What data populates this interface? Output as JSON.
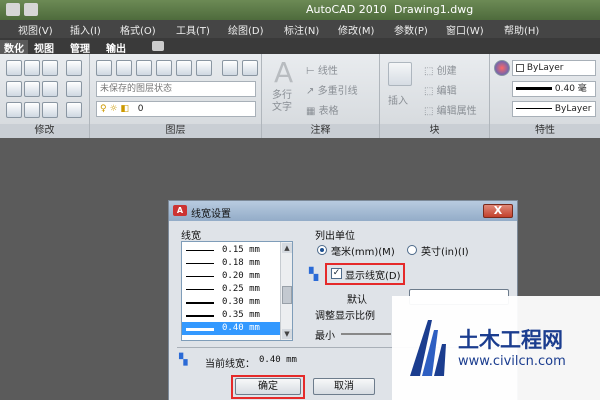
{
  "window": {
    "app_title": "AutoCAD 2010",
    "file_title": "Drawing1.dwg"
  },
  "menu": {
    "items": [
      "视图(V)",
      "插入(I)",
      "格式(O)",
      "工具(T)",
      "绘图(D)",
      "标注(N)",
      "修改(M)",
      "参数(P)",
      "窗口(W)",
      "帮助(H)"
    ]
  },
  "ribbon_tabs": {
    "items": [
      "数化",
      "视图",
      "管理",
      "输出"
    ],
    "active": "数化"
  },
  "ribbon": {
    "layer_state": "未保存的图层状态",
    "layer_current": "0",
    "annotation": {
      "text_label": "多行文字",
      "linear": "线性",
      "multileader": "多重引线",
      "table": "表格"
    },
    "block": {
      "insert": "插入",
      "create": "创建",
      "edit": "编辑",
      "edit_attr": "编辑属性"
    },
    "properties": {
      "color": "ByLayer",
      "lineweight": "0.40 毫",
      "linetype": "ByLayer"
    },
    "panel_labels": {
      "modify": "修改",
      "layers": "图层",
      "annotation": "注释",
      "block": "块",
      "properties": "特性"
    }
  },
  "dialog": {
    "title": "线宽设置",
    "close_glyph": "X",
    "lineweights_label": "线宽",
    "lineweights": [
      {
        "label": "0.15 mm",
        "weight": 1
      },
      {
        "label": "0.18 mm",
        "weight": 1
      },
      {
        "label": "0.20 mm",
        "weight": 1
      },
      {
        "label": "0.25 mm",
        "weight": 1
      },
      {
        "label": "0.30 mm",
        "weight": 2
      },
      {
        "label": "0.35 mm",
        "weight": 2
      },
      {
        "label": "0.40 mm",
        "weight": 3
      }
    ],
    "selected_lineweight": "0.40 mm",
    "units_label": "列出单位",
    "unit_mm": "毫米(mm)(M)",
    "unit_inch": "英寸(in)(I)",
    "selected_unit": "mm",
    "display_lineweight": "显示线宽(D)",
    "display_lineweight_checked": true,
    "default_label": "默认",
    "adjust_scale_label": "调整显示比例",
    "min_label": "最小",
    "current_label": "当前线宽：",
    "current_value": "0.40 mm",
    "ok": "确定",
    "cancel": "取消"
  },
  "watermark": {
    "title": "土木工程网",
    "url": "www.civilcn.com"
  },
  "colors": {
    "highlight": "#e52a2a",
    "selection": "#3399ff",
    "watermark": "#1b3d8f"
  }
}
